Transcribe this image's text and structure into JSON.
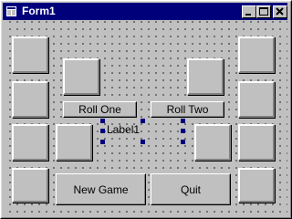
{
  "window": {
    "title": "Form1"
  },
  "caption_buttons": [
    "minimize-icon",
    "maximize-icon",
    "close-icon"
  ],
  "controls": {
    "roll_one": "Roll One",
    "roll_two": "Roll Two",
    "label1": "Label1",
    "new_game": "New Game",
    "quit": "Quit"
  },
  "colors": {
    "titlebar": "#00007b",
    "face": "#c0c0c0",
    "selection_handle": "#00007b"
  }
}
